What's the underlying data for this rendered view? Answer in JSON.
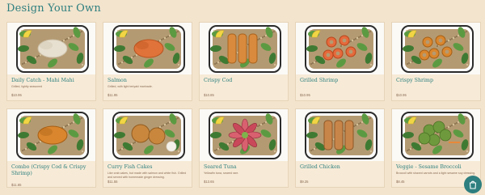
{
  "header": {
    "title": "Design Your Own"
  },
  "items": [
    {
      "name": "Daily Catch - Mahi Mahi",
      "desc": "Grilled, lightly seasoned",
      "price": "$10.95",
      "protein": "mahi"
    },
    {
      "name": "Salmon",
      "desc": "Grilled, with light teriyaki marinade.",
      "price": "$11.95",
      "protein": "salmon"
    },
    {
      "name": "Crispy Cod",
      "desc": "",
      "price": "$10.85",
      "protein": "cod"
    },
    {
      "name": "Grilled Shrimp",
      "desc": "",
      "price": "$10.95",
      "protein": "shrimp"
    },
    {
      "name": "Crispy Shrimp",
      "desc": "",
      "price": "$10.95",
      "protein": "crispyshrimp"
    },
    {
      "name": "Combo (Crispy Cod & Crispy Shrimp)",
      "desc": "",
      "price": "$11.65",
      "protein": "combo"
    },
    {
      "name": "Curry Fish Cakes",
      "desc": "Like crab cakes, but made with salmon and white fish. Grilled and served with homemade ginger dressing.",
      "price": "$11.55",
      "protein": "cakes"
    },
    {
      "name": "Seared Tuna",
      "desc": "Yellowfin tuna, seared rare.",
      "price": "$13.65",
      "protein": "tuna"
    },
    {
      "name": "Grilled Chicken",
      "desc": "",
      "price": "$9.25",
      "protein": "chicken"
    },
    {
      "name": "Veggie - Sesame Broccoli",
      "desc": "Broccoli with shaved carrots and a light sesame soy dressing.",
      "price": "$8.45",
      "protein": "broccoli"
    }
  ],
  "colors": {
    "accent": "#2e7f7f",
    "background": "#f3e4cd",
    "card": "#f7ebd7"
  },
  "cart": {
    "icon": "shopping-bag-icon"
  }
}
